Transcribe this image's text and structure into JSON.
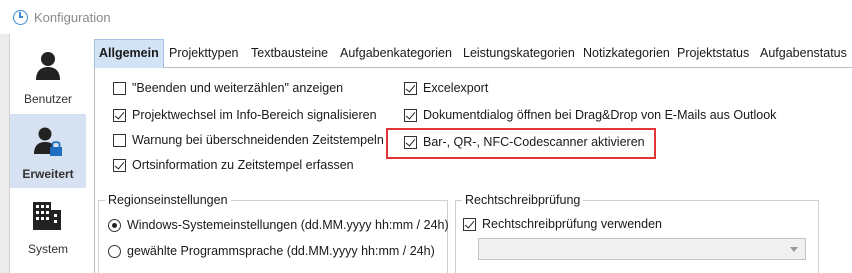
{
  "window": {
    "title": "Konfiguration",
    "icon": "clock-icon"
  },
  "sidebar": {
    "items": [
      {
        "label": "Benutzer",
        "icon": "user-icon",
        "active": false
      },
      {
        "label": "Erweitert",
        "icon": "user-lock-icon",
        "active": true
      },
      {
        "label": "System",
        "icon": "building-icon",
        "active": false
      }
    ]
  },
  "tabs": [
    {
      "label": "Allgemein",
      "active": true
    },
    {
      "label": "Projekttypen"
    },
    {
      "label": "Textbausteine"
    },
    {
      "label": "Aufgabenkategorien"
    },
    {
      "label": "Leistungskategorien"
    },
    {
      "label": "Notizkategorien"
    },
    {
      "label": "Projektstatus"
    },
    {
      "label": "Aufgabenstatus"
    }
  ],
  "options_left": [
    {
      "label": "\"Beenden und weiterzählen\" anzeigen",
      "checked": false
    },
    {
      "label": "Projektwechsel im Info-Bereich signalisieren",
      "checked": true
    },
    {
      "label": "Warnung bei überschneidenden Zeitstempeln",
      "checked": false
    },
    {
      "label": "Ortsinformation zu Zeitstempel erfassen",
      "checked": true
    }
  ],
  "options_right": [
    {
      "label": "Excelexport",
      "checked": true
    },
    {
      "label": "Dokumentdialog öffnen bei Drag&Drop von E-Mails aus Outlook",
      "checked": true
    },
    {
      "label": "Bar-, QR-, NFC-Codescanner aktivieren",
      "checked": true,
      "highlighted": true
    }
  ],
  "region": {
    "title": "Regionseinstellungen",
    "options": [
      {
        "label": "Windows-Systemeinstellungen (dd.MM.yyyy hh:mm / 24h)",
        "selected": true
      },
      {
        "label": "gewählte Programmsprache (dd.MM.yyyy hh:mm / 24h)",
        "selected": false
      }
    ]
  },
  "spelling": {
    "title": "Rechtschreibprüfung",
    "checkbox_label": "Rechtschreibprüfung verwenden",
    "checked": true,
    "dropdown_value": ""
  },
  "colors": {
    "accent": "#d6e2f1",
    "tab_active": "#d2e3f5",
    "highlight": "#e03535"
  }
}
